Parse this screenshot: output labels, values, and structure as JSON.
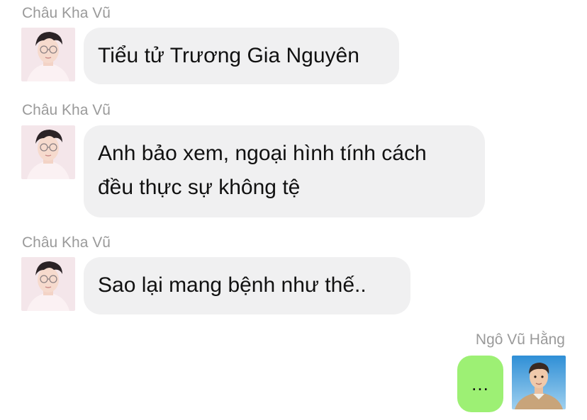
{
  "messages": [
    {
      "sender": "Châu Kha Vũ",
      "lines": [
        "Tiểu tử Trương Gia Nguyên"
      ],
      "avatar": "profile-photo-icon"
    },
    {
      "sender": "Châu Kha Vũ",
      "lines": [
        "Anh bảo xem, ngoại hình tính cách",
        "đều thực sự không tệ"
      ],
      "avatar": "profile-photo-icon"
    },
    {
      "sender": "Châu Kha Vũ",
      "lines": [
        "Sao lại mang bệnh như thế.."
      ],
      "avatar": "profile-photo-icon"
    },
    {
      "sender": "Ngô Vũ Hằng",
      "lines": [
        "..."
      ],
      "avatar": "profile-photo-icon"
    }
  ],
  "colors": {
    "incoming_bubble": "#f0f0f1",
    "outgoing_bubble": "#9df074",
    "sender_name": "#9a9a9a",
    "message_text": "#111111"
  }
}
